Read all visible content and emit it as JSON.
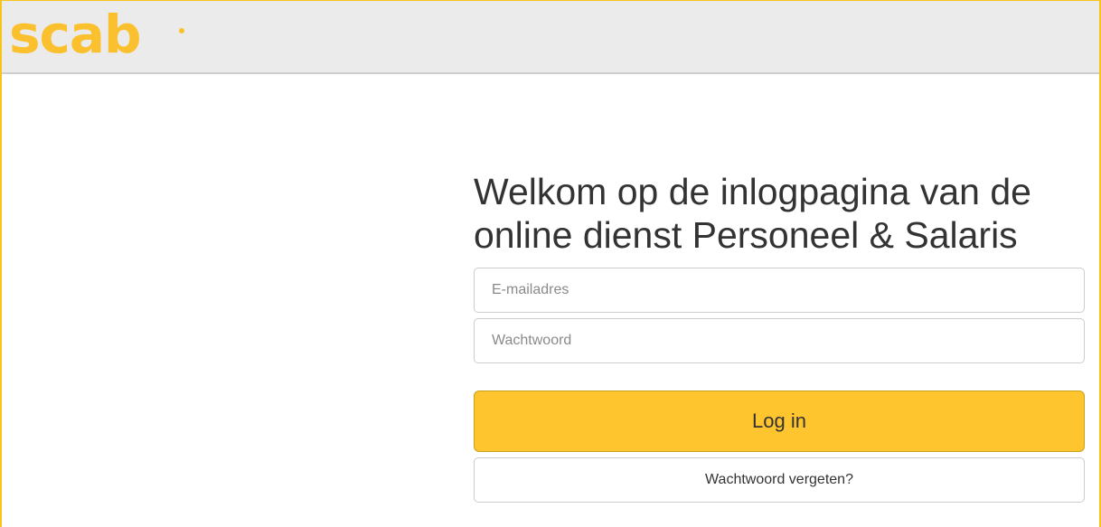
{
  "header": {
    "logo_text": "scab"
  },
  "login": {
    "title_line1": "Welkom op de inlogpagina van de",
    "title_line2": "online dienst Personeel & Salaris",
    "email_placeholder": "E-mailadres",
    "password_placeholder": "Wachtwoord",
    "login_button": "Log in",
    "forgot_button": "Wachtwoord vergeten?"
  },
  "colors": {
    "brand": "#fbc02d",
    "button": "#fec52e",
    "header_bg": "#ebebeb",
    "frame": "#f5c518"
  }
}
